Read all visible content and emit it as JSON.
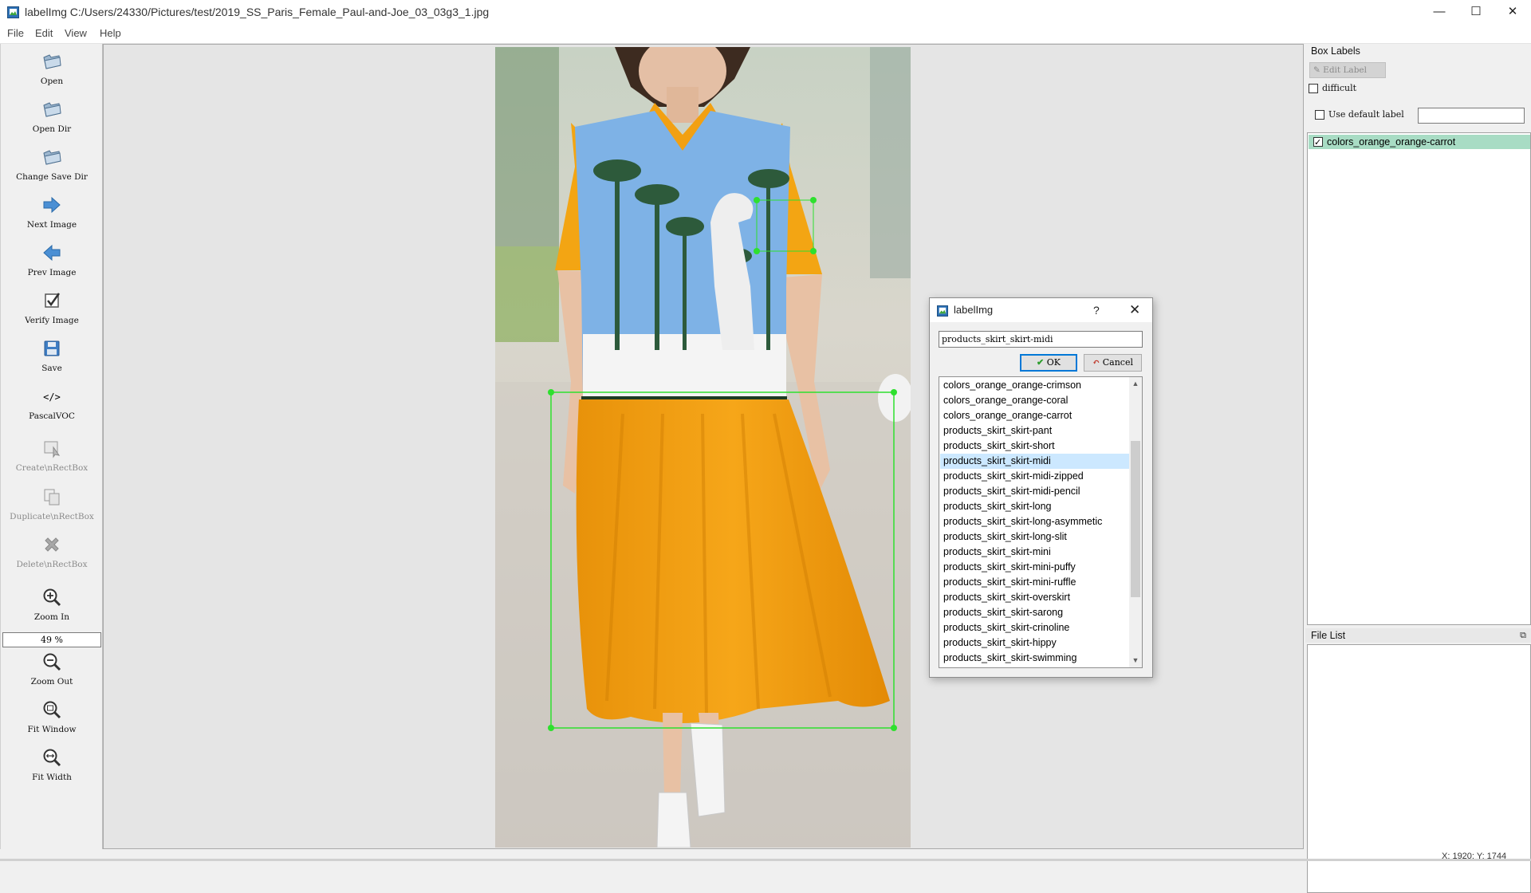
{
  "window": {
    "title": "labelImg C:/Users/24330/Pictures/test/2019_SS_Paris_Female_Paul-and-Joe_03_03g3_1.jpg",
    "controls": {
      "minimize": "—",
      "maximize": "☐",
      "close": "✕"
    }
  },
  "menu": [
    "File",
    "Edit",
    "View",
    "Help"
  ],
  "toolbar": {
    "open": "Open",
    "open_dir": "Open Dir",
    "change_save_dir": "Change Save Dir",
    "next_image": "Next Image",
    "prev_image": "Prev Image",
    "verify_image": "Verify Image",
    "save": "Save",
    "format_icon": "</>",
    "format": "PascalVOC",
    "create_rect": "Create\\nRectBox",
    "duplicate_rect": "Duplicate\\nRectBox",
    "delete_rect": "Delete\\nRectBox",
    "zoom_in": "Zoom In",
    "zoom_value": "49 %",
    "zoom_out": "Zoom Out",
    "fit_window": "Fit Window",
    "fit_width": "Fit Width"
  },
  "dialog": {
    "title": "labelImg",
    "help": "?",
    "close": "✕",
    "input_value": "products_skirt_skirt-midi",
    "ok_label": "OK",
    "cancel_label": "Cancel",
    "items": [
      "colors_orange_orange-crimson",
      "colors_orange_orange-coral",
      "colors_orange_orange-carrot",
      "products_skirt_skirt-pant",
      "products_skirt_skirt-short",
      "products_skirt_skirt-midi",
      "products_skirt_skirt-midi-zipped",
      "products_skirt_skirt-midi-pencil",
      "products_skirt_skirt-long",
      "products_skirt_skirt-long-asymmetic",
      "products_skirt_skirt-long-slit",
      "products_skirt_skirt-mini",
      "products_skirt_skirt-mini-puffy",
      "products_skirt_skirt-mini-ruffle",
      "products_skirt_skirt-overskirt",
      "products_skirt_skirt-sarong",
      "products_skirt_skirt-crinoline",
      "products_skirt_skirt-hippy",
      "products_skirt_skirt-swimming"
    ],
    "selected_item": "products_skirt_skirt-midi"
  },
  "box_labels": {
    "title": "Box Labels",
    "edit_label": "Edit Label",
    "difficult": "difficult",
    "use_default_label": "Use default label",
    "default_label_value": "",
    "labels": [
      {
        "text": "colors_orange_orange-carrot",
        "checked": true
      }
    ]
  },
  "file_list": {
    "title": "File List"
  },
  "status": {
    "coords": "X: 1920; Y: 1744"
  },
  "colors": {
    "box_outline": "#2ee02e",
    "selection": "#cce8ff",
    "label_highlight": "#a8dcc4"
  }
}
